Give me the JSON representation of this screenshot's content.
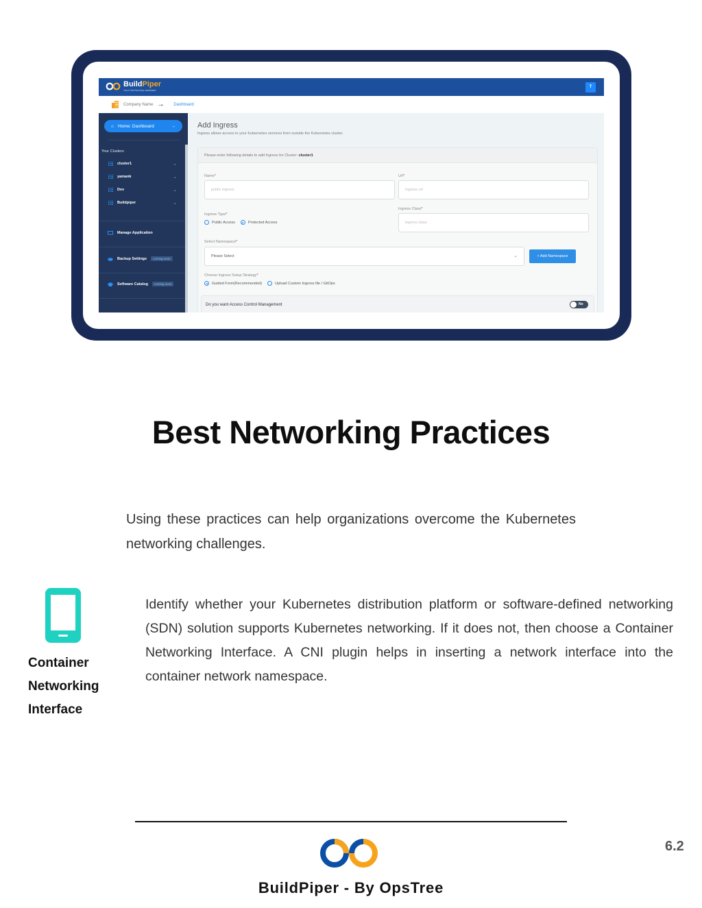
{
  "screenshot": {
    "app": {
      "logo_brand": "Build",
      "logo_brand_accent": "Piper",
      "logo_tagline": "Your DevSecOps assistant",
      "avatar_initial": "T",
      "breadcrumb": {
        "company": "Company Name",
        "current": "Dashboard"
      }
    },
    "sidebar": {
      "home_button": "Home: Dashboard",
      "clusters_title": "Your Clusters",
      "clusters": [
        "cluster1",
        "yamank",
        "Dev",
        "Buildpiper"
      ],
      "items": [
        {
          "label": "Manage Application",
          "badge": null
        },
        {
          "label": "Backup Settings",
          "badge": "coming soon"
        },
        {
          "label": "Software Catalog",
          "badge": "coming soon"
        }
      ]
    },
    "form": {
      "title": "Add Ingress",
      "subtitle": "Ingress allows access to your Kubernetes services from outside the Kubernetes cluster.",
      "card_header": "Please enter following details to add Ingress for Cluster:",
      "cluster_name": "cluster1",
      "name_label": "Name",
      "name_placeholder": "public ingress",
      "url_label": "Url",
      "url_placeholder": "Ingress url",
      "ingress_type_label": "Ingress Type",
      "ingress_type_options": [
        "Public Access",
        "Protected Access"
      ],
      "ingress_type_selected": "Protected Access",
      "ingress_class_label": "Ingress Class",
      "ingress_class_placeholder": "ingress class",
      "namespace_label": "Select Namespace",
      "namespace_value": "Please Select",
      "add_namespace_button": "+ Add Namespace",
      "strategy_label": "Choose Ingress Setup Strategy",
      "strategy_options": [
        "Guided Form(Recommended)",
        "Upload Custom Ingress file / GitOps"
      ],
      "strategy_selected": "Guided Form(Recommended)",
      "access_control_label": "Do you want Access Control Management",
      "access_control_toggle": "No"
    }
  },
  "document": {
    "heading": "Best Networking Practices",
    "intro": "Using these practices can help organizations overcome the Kubernetes networking challenges.",
    "practice": {
      "icon": "mobile-device-icon",
      "title_lines": [
        "Container",
        "Networking",
        "Interface"
      ],
      "text": "Identify whether your Kubernetes distribution platform or software-defined networking (SDN) solution supports Kubernetes networking. If it does not, then choose a Container Networking Interface. A CNI plugin helps in inserting a network interface into the container network namespace."
    },
    "footer": {
      "text": "BuildPiper - By OpsTree",
      "page_number": "6.2"
    },
    "colors": {
      "frame": "#1a2a57",
      "accent_teal": "#1fd1c1",
      "brand_blue": "#0b4fa6",
      "brand_orange": "#f7a21b"
    }
  }
}
